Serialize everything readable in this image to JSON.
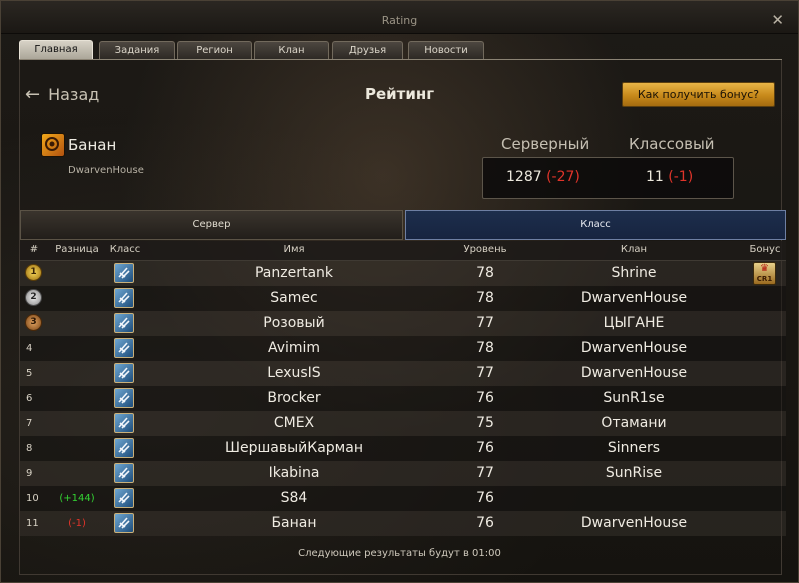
{
  "window": {
    "title": "Rating"
  },
  "tabs": [
    {
      "label": "Главная",
      "active": true
    },
    {
      "label": "Задания",
      "active": false
    },
    {
      "label": "Регион",
      "active": false
    },
    {
      "label": "Клан",
      "active": false
    },
    {
      "label": "Друзья",
      "active": false
    },
    {
      "label": "Новости",
      "active": false
    }
  ],
  "header": {
    "back_label": "Назад",
    "page_title": "Рейтинг",
    "bonus_button": "Как получить бонус?"
  },
  "player": {
    "name": "Банан",
    "clan": "DwarvenHouse",
    "server_label": "Серверный",
    "class_label": "Классовый",
    "server_rank": "1287",
    "server_change": "(-27)",
    "class_rank": "11",
    "class_change": "(-1)"
  },
  "subtabs": {
    "server": "Сервер",
    "class": "Класс",
    "active": "class"
  },
  "columns": {
    "rank": "#",
    "diff": "Разница",
    "class": "Класс",
    "name": "Имя",
    "level": "Уровень",
    "clan": "Клан",
    "bonus": "Бонус"
  },
  "rows": [
    {
      "rank": "1",
      "diff": "",
      "name": "Panzertank",
      "level": "78",
      "clan": "Shrine",
      "bonus": "CR1"
    },
    {
      "rank": "2",
      "diff": "",
      "name": "Samec",
      "level": "78",
      "clan": "DwarvenHouse",
      "bonus": ""
    },
    {
      "rank": "3",
      "diff": "",
      "name": "Розовый",
      "level": "77",
      "clan": "ЦЫГАНЕ",
      "bonus": ""
    },
    {
      "rank": "4",
      "diff": "",
      "name": "Avimim",
      "level": "78",
      "clan": "DwarvenHouse",
      "bonus": ""
    },
    {
      "rank": "5",
      "diff": "",
      "name": "LexusIS",
      "level": "77",
      "clan": "DwarvenHouse",
      "bonus": ""
    },
    {
      "rank": "6",
      "diff": "",
      "name": "Brocker",
      "level": "76",
      "clan": "SunR1se",
      "bonus": ""
    },
    {
      "rank": "7",
      "diff": "",
      "name": "CMEX",
      "level": "75",
      "clan": "Отамани",
      "bonus": ""
    },
    {
      "rank": "8",
      "diff": "",
      "name": "ШершавыйКарман",
      "level": "76",
      "clan": "Sinners",
      "bonus": ""
    },
    {
      "rank": "9",
      "diff": "",
      "name": "Ikabina",
      "level": "77",
      "clan": "SunRise",
      "bonus": ""
    },
    {
      "rank": "10",
      "diff": "(+144)",
      "name": "S84",
      "level": "76",
      "clan": "",
      "bonus": ""
    },
    {
      "rank": "11",
      "diff": "(-1)",
      "name": "Банан",
      "level": "76",
      "clan": "DwarvenHouse",
      "bonus": ""
    }
  ],
  "footer": "Следующие результаты будут в 01:00",
  "colors": {
    "accent_orange": "#d59a2a",
    "negative": "#e0342a",
    "positive": "#34d434",
    "active_subtab": "#1d2e4c"
  }
}
